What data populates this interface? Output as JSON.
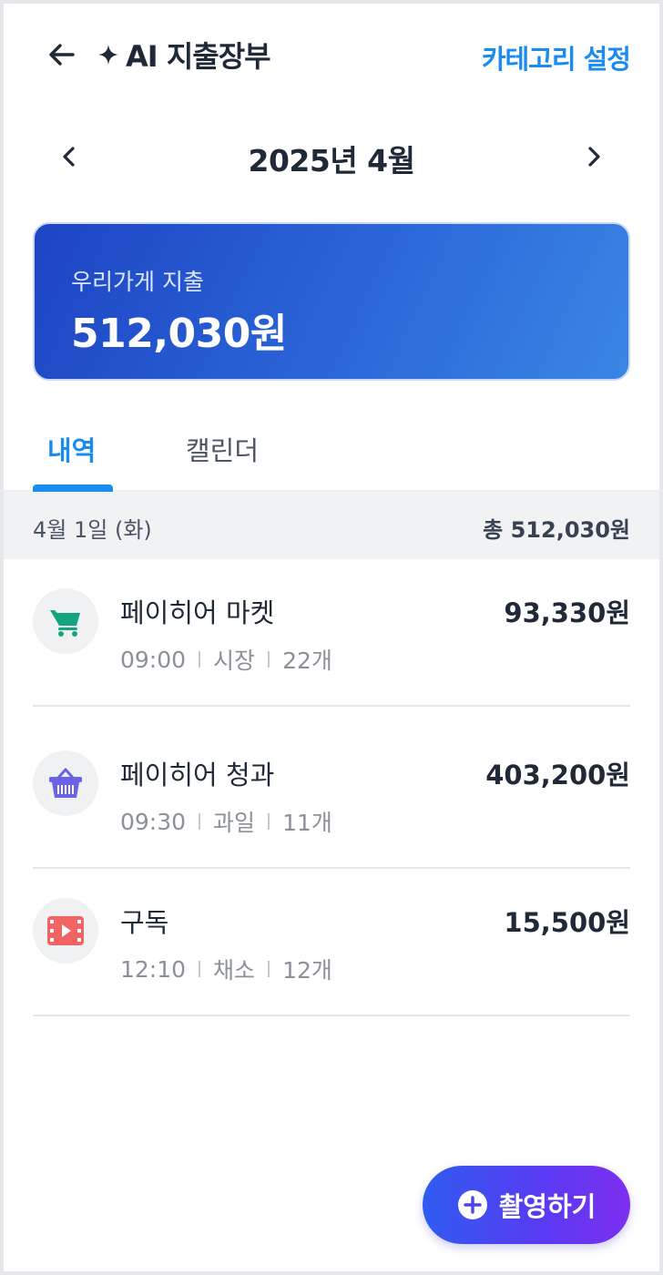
{
  "header": {
    "title": "AI 지출장부",
    "category_settings_label": "카테고리 설정"
  },
  "month_nav": {
    "label": "2025년 4월"
  },
  "summary": {
    "label": "우리가게 지출",
    "amount": "512,030원"
  },
  "tabs": [
    {
      "label": "내역",
      "active": true
    },
    {
      "label": "캘린더",
      "active": false
    }
  ],
  "date_group": {
    "date": "4월 1일 (화)",
    "total": "총 512,030원"
  },
  "items": [
    {
      "name": "페이히어 마켓",
      "amount": "93,330원",
      "time": "09:00",
      "category": "시장",
      "count": "22개",
      "icon": "cart-icon"
    },
    {
      "name": "페이히어 청과",
      "amount": "403,200원",
      "time": "09:30",
      "category": "과일",
      "count": "11개",
      "icon": "basket-icon"
    },
    {
      "name": "구독",
      "amount": "15,500원",
      "time": "12:10",
      "category": "채소",
      "count": "12개",
      "icon": "video-icon"
    }
  ],
  "fab": {
    "label": "촬영하기"
  },
  "colors": {
    "accent": "#1a8cf0",
    "card_start": "#1e44c4",
    "card_end": "#3a86e4",
    "fab_start": "#2f5bf0",
    "fab_end": "#7d2ff0"
  }
}
